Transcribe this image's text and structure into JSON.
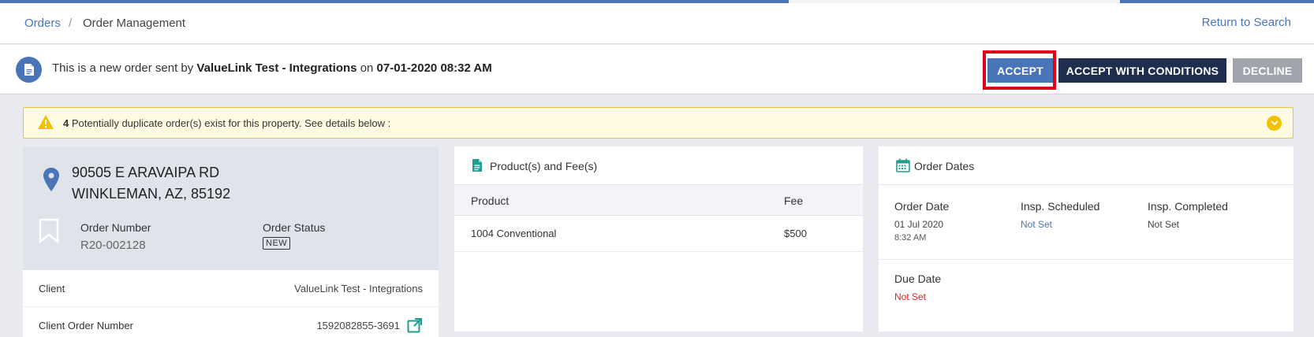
{
  "breadcrumb": {
    "orders": "Orders",
    "separator": "/",
    "current": "Order Management",
    "return_link": "Return to Search"
  },
  "notice": {
    "prefix": "This is a new order sent by",
    "sender": "ValueLink Test - Integrations",
    "on": "on",
    "datetime": "07-01-2020 08:32 AM"
  },
  "actions": {
    "accept": "ACCEPT",
    "accept_conditions": "ACCEPT WITH CONDITIONS",
    "decline": "DECLINE"
  },
  "warning": {
    "count": "4",
    "text": "Potentially duplicate order(s) exist for this property. See details below :"
  },
  "property": {
    "address_line1": "90505 E ARAVAIPA RD",
    "address_line2": "WINKLEMAN, AZ, 85192",
    "order_number_label": "Order Number",
    "order_number": "R20-002128",
    "order_status_label": "Order Status",
    "order_status": "NEW",
    "rows": [
      {
        "label": "Client",
        "value": "ValueLink Test - Integrations"
      },
      {
        "label": "Client Order Number",
        "value": "1592082855-3691"
      }
    ]
  },
  "products": {
    "title": "Product(s) and Fee(s)",
    "columns": [
      "Product",
      "Fee"
    ],
    "rows": [
      {
        "product": "1004 Conventional",
        "fee": "$500"
      }
    ]
  },
  "dates": {
    "title": "Order Dates",
    "order_date_label": "Order Date",
    "order_date": "01 Jul 2020",
    "order_time": "8:32 AM",
    "insp_scheduled_label": "Insp. Scheduled",
    "insp_scheduled": "Not Set",
    "insp_completed_label": "Insp. Completed",
    "insp_completed": "Not Set",
    "due_date_label": "Due Date",
    "due_date": "Not Set"
  },
  "colors": {
    "primary": "#4a74b8",
    "navy": "#1f2d4e",
    "decline": "#a0a4ab",
    "highlight": "#e3001b",
    "warning_bg": "#fffbe2",
    "warning_accent": "#f2c200",
    "not_set_red": "#e02020"
  },
  "icons": [
    "document-icon",
    "warning-icon",
    "chevron-down-icon",
    "map-pin-icon",
    "bookmark-icon",
    "external-link-icon",
    "file-icon",
    "calendar-icon"
  ]
}
